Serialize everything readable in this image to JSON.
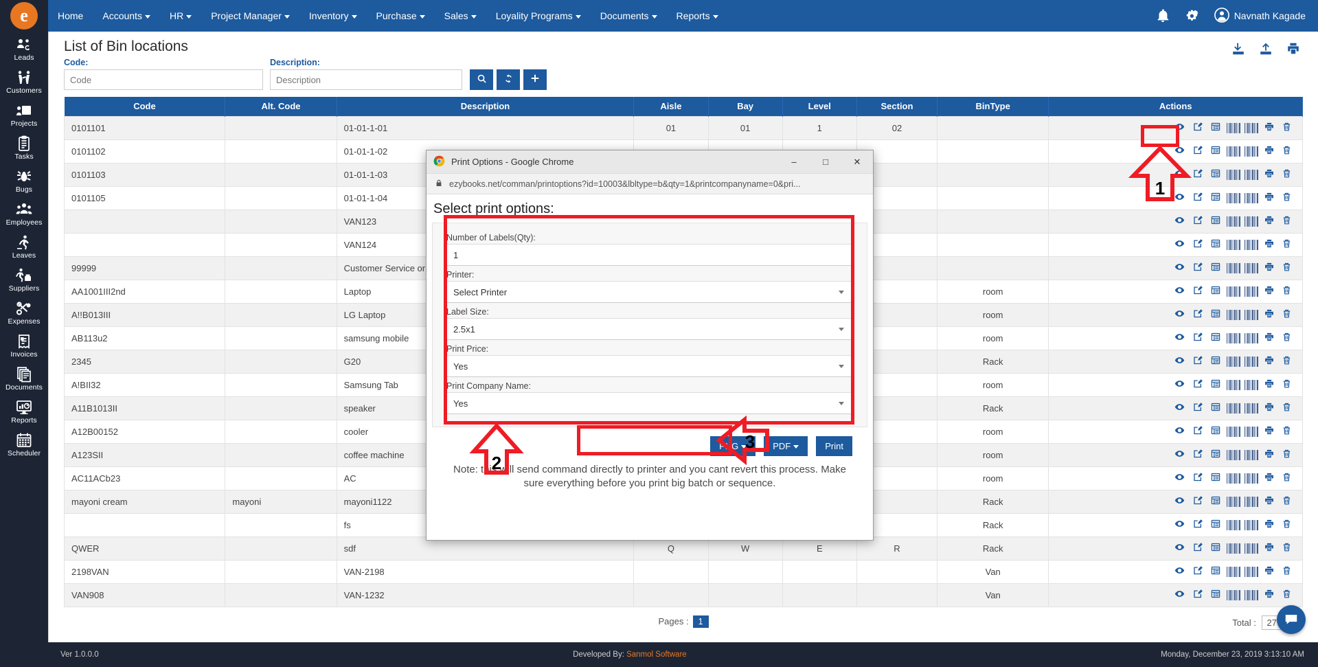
{
  "brand": {
    "logo_letter": "e",
    "accent": "#e87722",
    "primary": "#1d5a9e",
    "dark": "#1d2535"
  },
  "topnav": {
    "items": [
      {
        "label": "Home",
        "caret": false
      },
      {
        "label": "Accounts",
        "caret": true
      },
      {
        "label": "HR",
        "caret": true
      },
      {
        "label": "Project Manager",
        "caret": true
      },
      {
        "label": "Inventory",
        "caret": true
      },
      {
        "label": "Purchase",
        "caret": true
      },
      {
        "label": "Sales",
        "caret": true
      },
      {
        "label": "Loyality Programs",
        "caret": true
      },
      {
        "label": "Documents",
        "caret": true
      },
      {
        "label": "Reports",
        "caret": true
      }
    ],
    "bell_icon": "bell-icon",
    "settings_icon": "gears-icon",
    "user_name": "Navnath Kagade",
    "user_icon": "user-avatar-icon"
  },
  "sidebar": {
    "items": [
      {
        "label": "Leads",
        "icon": "leads-icon"
      },
      {
        "label": "Customers",
        "icon": "customers-icon"
      },
      {
        "label": "Projects",
        "icon": "projects-icon"
      },
      {
        "label": "Tasks",
        "icon": "tasks-clipboard-icon"
      },
      {
        "label": "Bugs",
        "icon": "bug-icon"
      },
      {
        "label": "Employees",
        "icon": "employees-icon"
      },
      {
        "label": "Leaves",
        "icon": "leaves-walking-icon"
      },
      {
        "label": "Suppliers",
        "icon": "suppliers-icon"
      },
      {
        "label": "Expenses",
        "icon": "expenses-scissors-icon"
      },
      {
        "label": "Invoices",
        "icon": "invoice-icon"
      },
      {
        "label": "Documents",
        "icon": "documents-icon"
      },
      {
        "label": "Reports",
        "icon": "reports-chart-icon"
      },
      {
        "label": "Scheduler",
        "icon": "calendar-icon"
      }
    ]
  },
  "page": {
    "title": "List of Bin locations",
    "head_icons": [
      {
        "name": "download-icon"
      },
      {
        "name": "upload-icon"
      },
      {
        "name": "print-icon"
      }
    ]
  },
  "filters": {
    "code_label": "Code:",
    "code_placeholder": "Code",
    "code_value": "",
    "desc_label": "Description:",
    "desc_placeholder": "Description",
    "desc_value": "",
    "search_icon": "search-icon",
    "refresh_icon": "refresh-icon",
    "add_icon": "plus-icon"
  },
  "table": {
    "columns": [
      "Code",
      "Alt. Code",
      "Description",
      "Aisle",
      "Bay",
      "Level",
      "Section",
      "BinType",
      "Actions"
    ],
    "row_actions": [
      {
        "name": "view-icon"
      },
      {
        "name": "edit-icon"
      },
      {
        "name": "details-list-icon"
      },
      {
        "name": "barcode-icon"
      },
      {
        "name": "barcode-alt-icon"
      },
      {
        "name": "print-icon"
      },
      {
        "name": "delete-icon"
      }
    ],
    "rows": [
      {
        "code": "0101101",
        "alt": "",
        "desc": "01-01-1-01",
        "aisle": "01",
        "bay": "01",
        "level": "1",
        "section": "02",
        "bintype": ""
      },
      {
        "code": "0101102",
        "alt": "",
        "desc": "01-01-1-02",
        "aisle": "",
        "bay": "",
        "level": "",
        "section": "",
        "bintype": ""
      },
      {
        "code": "0101103",
        "alt": "",
        "desc": "01-01-1-03",
        "aisle": "",
        "bay": "",
        "level": "",
        "section": "",
        "bintype": ""
      },
      {
        "code": "0101105",
        "alt": "",
        "desc": "01-01-1-04",
        "aisle": "",
        "bay": "",
        "level": "",
        "section": "",
        "bintype": ""
      },
      {
        "code": "",
        "alt": "",
        "desc": "VAN123",
        "aisle": "",
        "bay": "",
        "level": "",
        "section": "",
        "bintype": ""
      },
      {
        "code": "",
        "alt": "",
        "desc": "VAN124",
        "aisle": "",
        "bay": "",
        "level": "",
        "section": "",
        "bintype": ""
      },
      {
        "code": "99999",
        "alt": "",
        "desc": "Customer Service or POS Counter",
        "aisle": "",
        "bay": "",
        "level": "",
        "section": "",
        "bintype": ""
      },
      {
        "code": "AA1001III2nd",
        "alt": "",
        "desc": "Laptop",
        "aisle": "",
        "bay": "",
        "level": "",
        "section": "",
        "bintype": "room"
      },
      {
        "code": "A!!B013III",
        "alt": "",
        "desc": "LG Laptop",
        "aisle": "",
        "bay": "",
        "level": "",
        "section": "",
        "bintype": "room"
      },
      {
        "code": "AB113u2",
        "alt": "",
        "desc": "samsung mobile",
        "aisle": "",
        "bay": "",
        "level": "",
        "section": "",
        "bintype": "room"
      },
      {
        "code": "2345",
        "alt": "",
        "desc": "G20",
        "aisle": "",
        "bay": "",
        "level": "",
        "section": "",
        "bintype": "Rack"
      },
      {
        "code": "A!BII32",
        "alt": "",
        "desc": "Samsung Tab",
        "aisle": "",
        "bay": "",
        "level": "",
        "section": "",
        "bintype": "room"
      },
      {
        "code": "A11B1013II",
        "alt": "",
        "desc": "speaker",
        "aisle": "",
        "bay": "",
        "level": "",
        "section": "",
        "bintype": "Rack"
      },
      {
        "code": "A12B00152",
        "alt": "",
        "desc": "cooler",
        "aisle": "",
        "bay": "",
        "level": "",
        "section": "",
        "bintype": "room"
      },
      {
        "code": "A123SII",
        "alt": "",
        "desc": "coffee machine",
        "aisle": "",
        "bay": "",
        "level": "",
        "section": "",
        "bintype": "room"
      },
      {
        "code": "AC11ACb23",
        "alt": "",
        "desc": "AC",
        "aisle": "",
        "bay": "",
        "level": "",
        "section": "",
        "bintype": "room"
      },
      {
        "code": "mayoni cream",
        "alt": "mayoni",
        "desc": "mayoni1122",
        "aisle": "",
        "bay": "",
        "level": "",
        "section": "",
        "bintype": "Rack"
      },
      {
        "code": "",
        "alt": "",
        "desc": "fs",
        "aisle": "",
        "bay": "",
        "level": "",
        "section": "",
        "bintype": "Rack"
      },
      {
        "code": "QWER",
        "alt": "",
        "desc": "sdf",
        "aisle": "Q",
        "bay": "W",
        "level": "E",
        "section": "R",
        "bintype": "Rack"
      },
      {
        "code": "2198VAN",
        "alt": "",
        "desc": "VAN-2198",
        "aisle": "",
        "bay": "",
        "level": "",
        "section": "",
        "bintype": "Van"
      },
      {
        "code": "VAN908",
        "alt": "",
        "desc": "VAN-1232",
        "aisle": "",
        "bay": "",
        "level": "",
        "section": "",
        "bintype": "Van"
      }
    ]
  },
  "pager": {
    "pages_label": "Pages :",
    "current_page": "1",
    "total_label": "Total :",
    "total_value": "27"
  },
  "footer": {
    "version": "Ver 1.0.0.0",
    "developed_by_label": "Developed By:",
    "developed_by_name": "Sanmol Software",
    "datetime": "Monday, December 23, 2019 3:13:10 AM"
  },
  "popup": {
    "title": "Print Options - Google Chrome",
    "favicon": "chrome-icon",
    "lock_icon": "lock-icon",
    "url": "ezybooks.net/comman/printoptions?id=10003&lbltype=b&qty=1&printcompanyname=0&pri...",
    "minimize_label": "–",
    "maximize_label": "□",
    "close_label": "✕",
    "heading": "Select print options:",
    "fields": [
      {
        "label": "Number of Labels(Qty):",
        "value": "1",
        "type": "text"
      },
      {
        "label": "Printer:",
        "value": "Select Printer",
        "type": "select"
      },
      {
        "label": "Label Size:",
        "value": "2.5x1",
        "type": "select"
      },
      {
        "label": "Print Price:",
        "value": "Yes",
        "type": "select"
      },
      {
        "label": "Print Company Name:",
        "value": "Yes",
        "type": "select"
      }
    ],
    "buttons": [
      {
        "label": "PNG",
        "caret": true
      },
      {
        "label": "PDF",
        "caret": true
      },
      {
        "label": "Print",
        "caret": false
      }
    ],
    "note": "Note: this will send command directly to printer and you cant revert this process. Make sure everything before you print big batch or sequence."
  },
  "annotations": {
    "color": "#ee1c25",
    "markers": [
      {
        "num": "1",
        "target": "barcode-action-icon"
      },
      {
        "num": "2",
        "target": "print-options-form"
      },
      {
        "num": "3",
        "target": "print-export-buttons"
      }
    ]
  }
}
